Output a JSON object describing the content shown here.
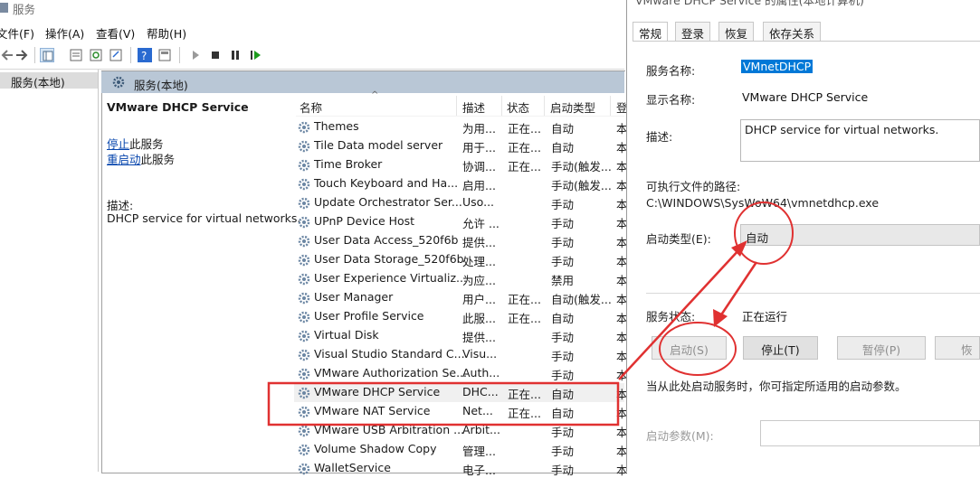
{
  "window": {
    "title": "服务"
  },
  "menu": {
    "items": [
      "文件(F)",
      "操作(A)",
      "查看(V)",
      "帮助(H)"
    ]
  },
  "tree": {
    "item": "服务(本地)"
  },
  "panel": {
    "header": "服务(本地)"
  },
  "detail": {
    "service_title": "VMware DHCP Service",
    "stop_link": "停止",
    "stop_suffix": "此服务",
    "restart_link": "重启动",
    "restart_suffix": "此服务",
    "desc_label": "描述:",
    "desc_text": "DHCP service for virtual networks."
  },
  "columns": {
    "name": "名称",
    "desc": "描述",
    "status": "状态",
    "startup": "启动类型",
    "logon": "登"
  },
  "rows": [
    {
      "name": "Themes",
      "desc": "为用...",
      "status": "正在...",
      "startup": "自动",
      "logon": "本"
    },
    {
      "name": "Tile Data model server",
      "desc": "用于...",
      "status": "正在...",
      "startup": "自动",
      "logon": "本"
    },
    {
      "name": "Time Broker",
      "desc": "协调...",
      "status": "正在...",
      "startup": "手动(触发...",
      "logon": "本"
    },
    {
      "name": "Touch Keyboard and Ha...",
      "desc": "启用...",
      "status": "",
      "startup": "手动(触发...",
      "logon": "本"
    },
    {
      "name": "Update Orchestrator Ser...",
      "desc": "Uso...",
      "status": "",
      "startup": "手动",
      "logon": "本"
    },
    {
      "name": "UPnP Device Host",
      "desc": "允许 ...",
      "status": "",
      "startup": "手动",
      "logon": "本"
    },
    {
      "name": "User Data Access_520f6b",
      "desc": "提供...",
      "status": "",
      "startup": "手动",
      "logon": "本"
    },
    {
      "name": "User Data Storage_520f6b",
      "desc": "处理...",
      "status": "",
      "startup": "手动",
      "logon": "本"
    },
    {
      "name": "User Experience Virtualiz...",
      "desc": "为应...",
      "status": "",
      "startup": "禁用",
      "logon": "本"
    },
    {
      "name": "User Manager",
      "desc": "用户...",
      "status": "正在...",
      "startup": "自动(触发...",
      "logon": "本"
    },
    {
      "name": "User Profile Service",
      "desc": "此服...",
      "status": "正在...",
      "startup": "自动",
      "logon": "本"
    },
    {
      "name": "Virtual Disk",
      "desc": "提供...",
      "status": "",
      "startup": "手动",
      "logon": "本"
    },
    {
      "name": "Visual Studio Standard C...",
      "desc": "Visu...",
      "status": "",
      "startup": "手动",
      "logon": "本"
    },
    {
      "name": "VMware Authorization Se...",
      "desc": "Auth...",
      "status": "",
      "startup": "手动",
      "logon": "本"
    },
    {
      "name": "VMware DHCP Service",
      "desc": "DHC...",
      "status": "正在...",
      "startup": "自动",
      "logon": "本"
    },
    {
      "name": "VMware NAT Service",
      "desc": "Net...",
      "status": "正在...",
      "startup": "自动",
      "logon": "本"
    },
    {
      "name": "VMware USB Arbitration ...",
      "desc": "Arbit...",
      "status": "",
      "startup": "手动",
      "logon": "本"
    },
    {
      "name": "Volume Shadow Copy",
      "desc": "管理...",
      "status": "",
      "startup": "手动",
      "logon": "本"
    },
    {
      "name": "WalletService",
      "desc": "电子...",
      "status": "",
      "startup": "手动",
      "logon": "本"
    }
  ],
  "dialog": {
    "title": "VMware DHCP Service 的属性(本地计算机)",
    "tabs": [
      "常规",
      "登录",
      "恢复",
      "依存关系"
    ],
    "service_name_label": "服务名称:",
    "service_name": "VMnetDHCP",
    "display_name_label": "显示名称:",
    "display_name": "VMware DHCP Service",
    "desc_label": "描述:",
    "desc_text": "DHCP service for virtual networks.",
    "path_label": "可执行文件的路径:",
    "path": "C:\\WINDOWS\\SysWoW64\\vmnetdhcp.exe",
    "startup_label": "启动类型(E):",
    "startup_value": "自动",
    "status_label": "服务状态:",
    "status_value": "正在运行",
    "buttons": {
      "start": "启动(S)",
      "stop": "停止(T)",
      "pause": "暂停(P)",
      "resume": "恢复"
    },
    "hint": "当从此处启动服务时，你可指定所适用的启动参数。",
    "param_label": "启动参数(M):"
  },
  "colors": {
    "annotation": "#e03131",
    "selection": "#0078d7",
    "panel_header": "#b9c7d6"
  }
}
